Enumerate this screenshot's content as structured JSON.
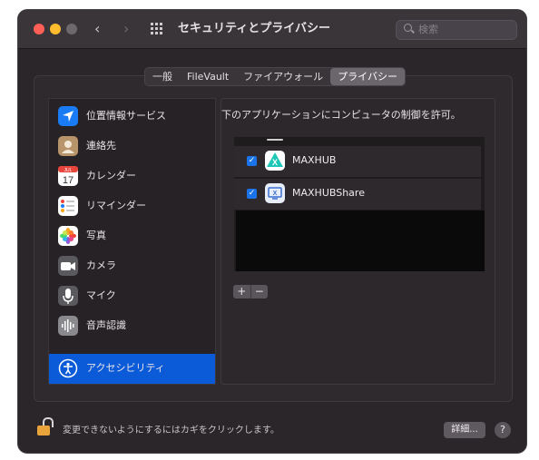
{
  "window": {
    "title": "セキュリティとプライバシー",
    "search_placeholder": "検索"
  },
  "tabs": [
    {
      "label": "一般"
    },
    {
      "label": "FileVault"
    },
    {
      "label": "ファイアウォール"
    },
    {
      "label": "プライバシー",
      "active": true
    }
  ],
  "sidebar": {
    "items": [
      {
        "label": "位置情報サービス",
        "icon": "location-icon"
      },
      {
        "label": "連絡先",
        "icon": "contacts-icon"
      },
      {
        "label": "カレンダー",
        "icon": "calendar-icon",
        "icon_month": "JUL",
        "icon_day": "17"
      },
      {
        "label": "リマインダー",
        "icon": "reminders-icon"
      },
      {
        "label": "写真",
        "icon": "photos-icon"
      },
      {
        "label": "カメラ",
        "icon": "camera-icon"
      },
      {
        "label": "マイク",
        "icon": "microphone-icon"
      },
      {
        "label": "音声認識",
        "icon": "speech-recognition-icon"
      },
      {
        "label": "アクセシビリティ",
        "icon": "accessibility-icon",
        "selected": true
      }
    ]
  },
  "content": {
    "title": "下のアプリケーションにコンピュータの制御を許可。",
    "apps": [
      {
        "name": "MAXHUB",
        "checked": true,
        "icon": "maxhub-icon"
      },
      {
        "name": "MAXHUBShare",
        "checked": true,
        "icon": "maxhubshare-icon"
      }
    ],
    "add_label": "+",
    "remove_label": "−"
  },
  "footer": {
    "lock_text": "変更できないようにするにはカギをクリックします。",
    "details_label": "詳細...",
    "help_label": "?"
  },
  "colors": {
    "window_bg": "#2a2629",
    "accent": "#0b5bd8",
    "checkbox": "#1a73e8",
    "lock": "#e8a33a"
  }
}
